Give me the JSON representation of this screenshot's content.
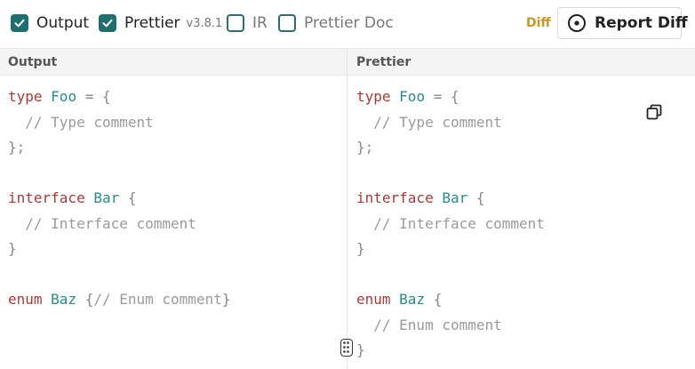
{
  "toolbar": {
    "options": [
      {
        "label": "Output",
        "checked": true
      },
      {
        "label": "Prettier",
        "version": "v3.8.1",
        "checked": true
      },
      {
        "label": "IR",
        "checked": false
      },
      {
        "label": "Prettier Doc",
        "checked": false
      }
    ],
    "diff_label": "Diff",
    "report_button_label": "Report Diff"
  },
  "panes": {
    "left": {
      "title": "Output",
      "lines": [
        [
          [
            "kw",
            "type"
          ],
          [
            "pu",
            " "
          ],
          [
            "ty",
            "Foo"
          ],
          [
            "pu",
            " = {"
          ]
        ],
        [
          [
            "cm",
            "  // Type comment"
          ]
        ],
        [
          [
            "pu",
            "};"
          ]
        ],
        [],
        [
          [
            "kw",
            "interface"
          ],
          [
            "pu",
            " "
          ],
          [
            "ty",
            "Bar"
          ],
          [
            "pu",
            " {"
          ]
        ],
        [
          [
            "cm",
            "  // Interface comment"
          ]
        ],
        [
          [
            "pu",
            "}"
          ]
        ],
        [],
        [
          [
            "kw",
            "enum"
          ],
          [
            "pu",
            " "
          ],
          [
            "ty",
            "Baz"
          ],
          [
            "pu",
            " {"
          ],
          [
            "cm",
            "// Enum comment"
          ],
          [
            "pu",
            "}"
          ]
        ]
      ]
    },
    "right": {
      "title": "Prettier",
      "lines": [
        [
          [
            "kw",
            "type"
          ],
          [
            "pu",
            " "
          ],
          [
            "ty",
            "Foo"
          ],
          [
            "pu",
            " = {"
          ]
        ],
        [
          [
            "cm",
            "  // Type comment"
          ]
        ],
        [
          [
            "pu",
            "};"
          ]
        ],
        [],
        [
          [
            "kw",
            "interface"
          ],
          [
            "pu",
            " "
          ],
          [
            "ty",
            "Bar"
          ],
          [
            "pu",
            " {"
          ]
        ],
        [
          [
            "cm",
            "  // Interface comment"
          ]
        ],
        [
          [
            "pu",
            "}"
          ]
        ],
        [],
        [
          [
            "kw",
            "enum"
          ],
          [
            "pu",
            " "
          ],
          [
            "ty",
            "Baz"
          ],
          [
            "pu",
            " {"
          ]
        ],
        [
          [
            "cm",
            "  // Enum comment"
          ]
        ],
        [
          [
            "pu",
            "}"
          ]
        ]
      ]
    }
  },
  "icons": {
    "check": "check-icon",
    "report": "target-circle-icon",
    "copy": "copy-icon",
    "handle": "drag-handle-icon"
  },
  "colors": {
    "accent": "#1f6f6f",
    "diff": "#c8962c",
    "keyword": "#a23b3b",
    "type_name": "#2a8a8a",
    "comment": "#9a9a9a"
  }
}
